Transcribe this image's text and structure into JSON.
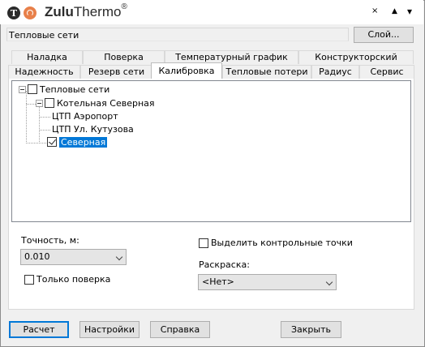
{
  "header": {
    "logo_letter": "T",
    "brand_bold": "Zulu",
    "brand_light": "Thermo",
    "brand_mark": "®",
    "window_controls": [
      "×",
      "▲",
      "▾"
    ]
  },
  "layer": {
    "value": "Тепловые сети",
    "button_label": "Слой..."
  },
  "tabs_row1": [
    "Наладка",
    "Поверка",
    "Температурный график",
    "Конструкторский"
  ],
  "tabs_row2": [
    "Надежность",
    "Резерв сети",
    "Калибровка",
    "Тепловые потери",
    "Радиус",
    "Сервис"
  ],
  "active_tab": "Калибровка",
  "tree": {
    "root": {
      "label": "Тепловые сети",
      "checked": false
    },
    "boiler": {
      "label": "Котельная Северная",
      "checked": false
    },
    "leaves": [
      "ЦТП Аэропорт",
      "ЦТП Ул. Кутузова"
    ],
    "network": {
      "label": "Северная",
      "checked": true,
      "selected": true
    }
  },
  "form": {
    "accuracy_label": "Точность, м:",
    "accuracy_value": "0.010",
    "only_check_label": "Только поверка",
    "highlight_label": "Выделить контрольные точки",
    "coloring_label": "Раскраска:",
    "coloring_value": "<Нет>"
  },
  "buttons": {
    "calculate": "Расчет",
    "settings": "Настройки",
    "help": "Справка",
    "close": "Закрыть"
  },
  "colors": {
    "selection": "#0078d7",
    "logo_orange": "#e8804a"
  }
}
